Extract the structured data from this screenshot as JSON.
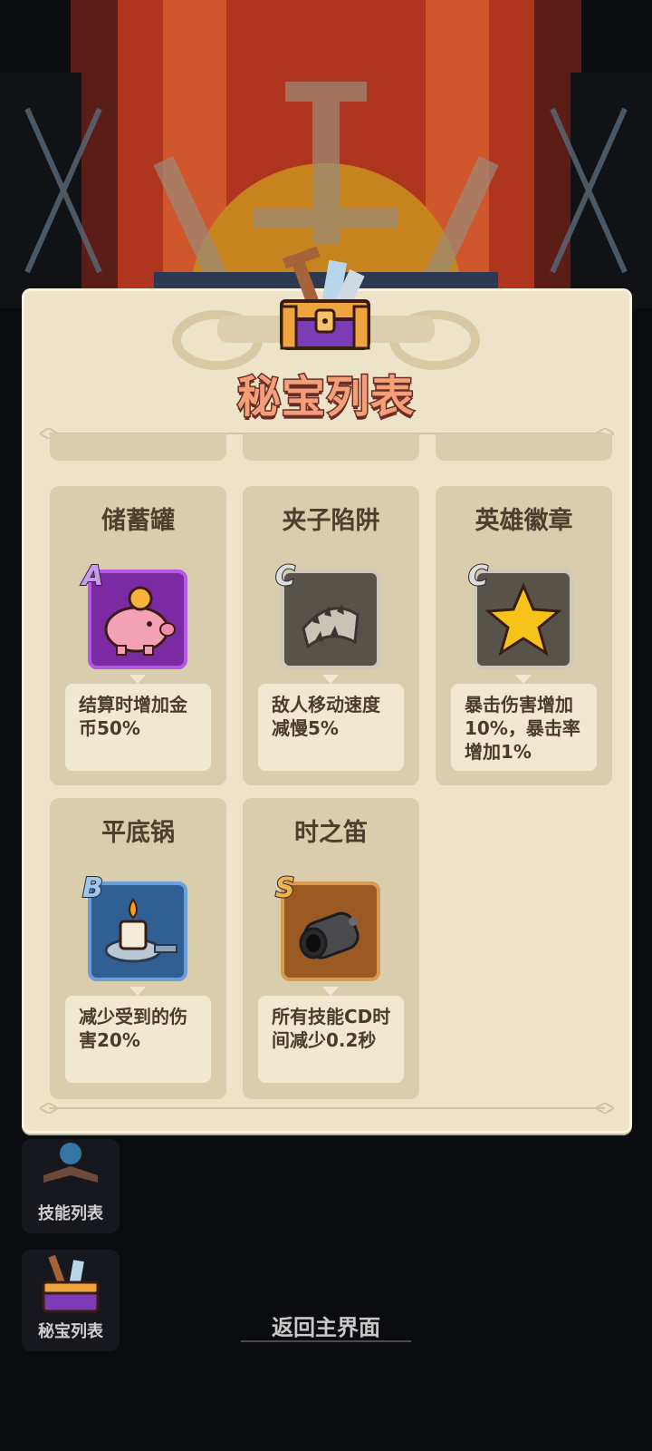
{
  "panel": {
    "title": "秘宝列表"
  },
  "items": [
    {
      "name": "储蓄罐",
      "grade": "A",
      "icon": "piggy-bank-icon",
      "frame_color": "#a23fd6",
      "desc": "结算时增加金币50%"
    },
    {
      "name": "夹子陷阱",
      "grade": "C",
      "icon": "bear-trap-icon",
      "frame_color": "#5a5650",
      "desc": "敌人移动速度减慢5%"
    },
    {
      "name": "英雄徽章",
      "grade": "C",
      "icon": "star-icon",
      "frame_color": "#5a5650",
      "desc": "暴击伤害增加10%，暴击率增加1%"
    },
    {
      "name": "平底锅",
      "grade": "B",
      "icon": "candle-pan-icon",
      "frame_color": "#3f7fc2",
      "desc": "减少受到的伤害20%"
    },
    {
      "name": "时之笛",
      "grade": "S",
      "icon": "cannon-icon",
      "frame_color": "#c07a2e",
      "desc": "所有技能CD时间减少0.2秒"
    }
  ],
  "side_buttons": [
    {
      "label": "技能列表",
      "icon": "spellbook-icon"
    },
    {
      "label": "秘宝列表",
      "icon": "treasure-chest-icon"
    }
  ],
  "footer": {
    "return_label": "返回主界面"
  }
}
